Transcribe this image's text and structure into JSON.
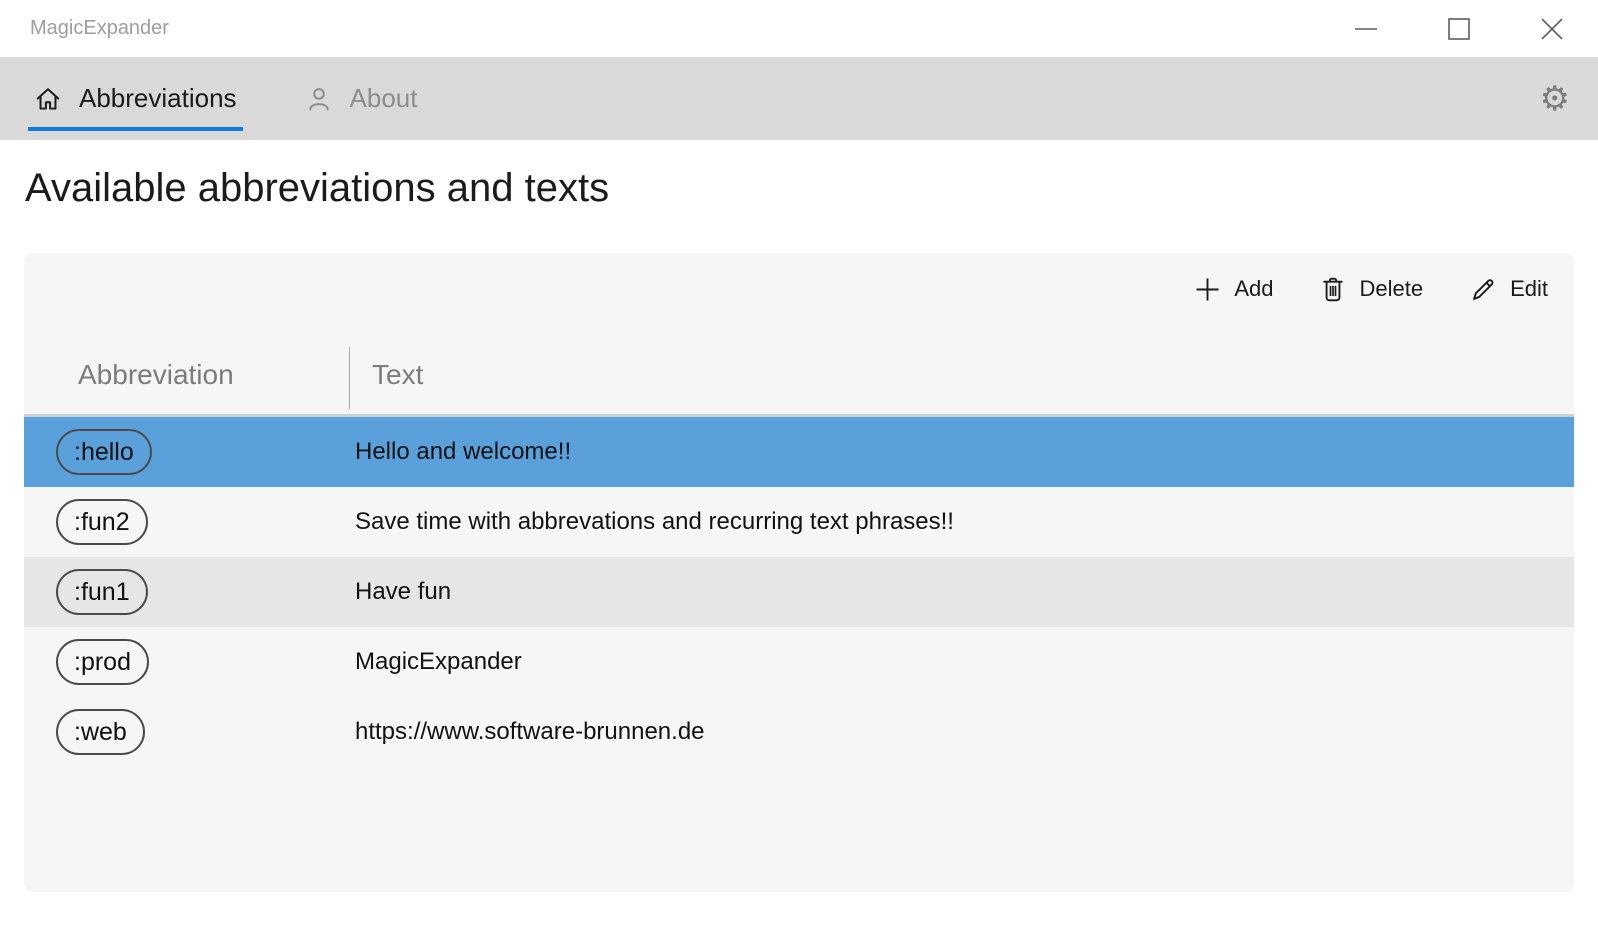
{
  "window": {
    "title": "MagicExpander"
  },
  "tabs": [
    {
      "label": "Abbreviations",
      "icon": "home-icon",
      "active": true
    },
    {
      "label": "About",
      "icon": "person-icon",
      "active": false
    }
  ],
  "settings": {
    "icon": "gear-icon",
    "glyph": "⚙"
  },
  "page": {
    "title": "Available abbreviations and texts"
  },
  "toolbar": {
    "add_label": "Add",
    "add_icon": "plus-icon",
    "delete_label": "Delete",
    "delete_icon": "trash-icon",
    "edit_label": "Edit",
    "edit_icon": "pencil-icon"
  },
  "table": {
    "columns": [
      "Abbreviation",
      "Text"
    ],
    "rows": [
      {
        "abbreviation": ":hello",
        "text": "Hello and welcome!!",
        "state": "selected"
      },
      {
        "abbreviation": ":fun2",
        "text": "Save time with abbrevations and recurring text phrases!!",
        "state": "normal"
      },
      {
        "abbreviation": ":fun1",
        "text": "Have fun",
        "state": "hover"
      },
      {
        "abbreviation": ":prod",
        "text": "MagicExpander",
        "state": "normal"
      },
      {
        "abbreviation": ":web",
        "text": "https://www.software-brunnen.de",
        "state": "normal"
      }
    ]
  },
  "window_controls": [
    "minimize-icon",
    "maximize-icon",
    "close-icon"
  ],
  "colors": {
    "accent_blue": "#5AA0DA",
    "tab_underline_blue": "#0F7AD8",
    "tabbar_bg": "#D9D9D9",
    "panel_bg": "#F6F6F6",
    "row_alt_gray": "#E6E6E6",
    "header_divider": "#C9D2DB"
  }
}
